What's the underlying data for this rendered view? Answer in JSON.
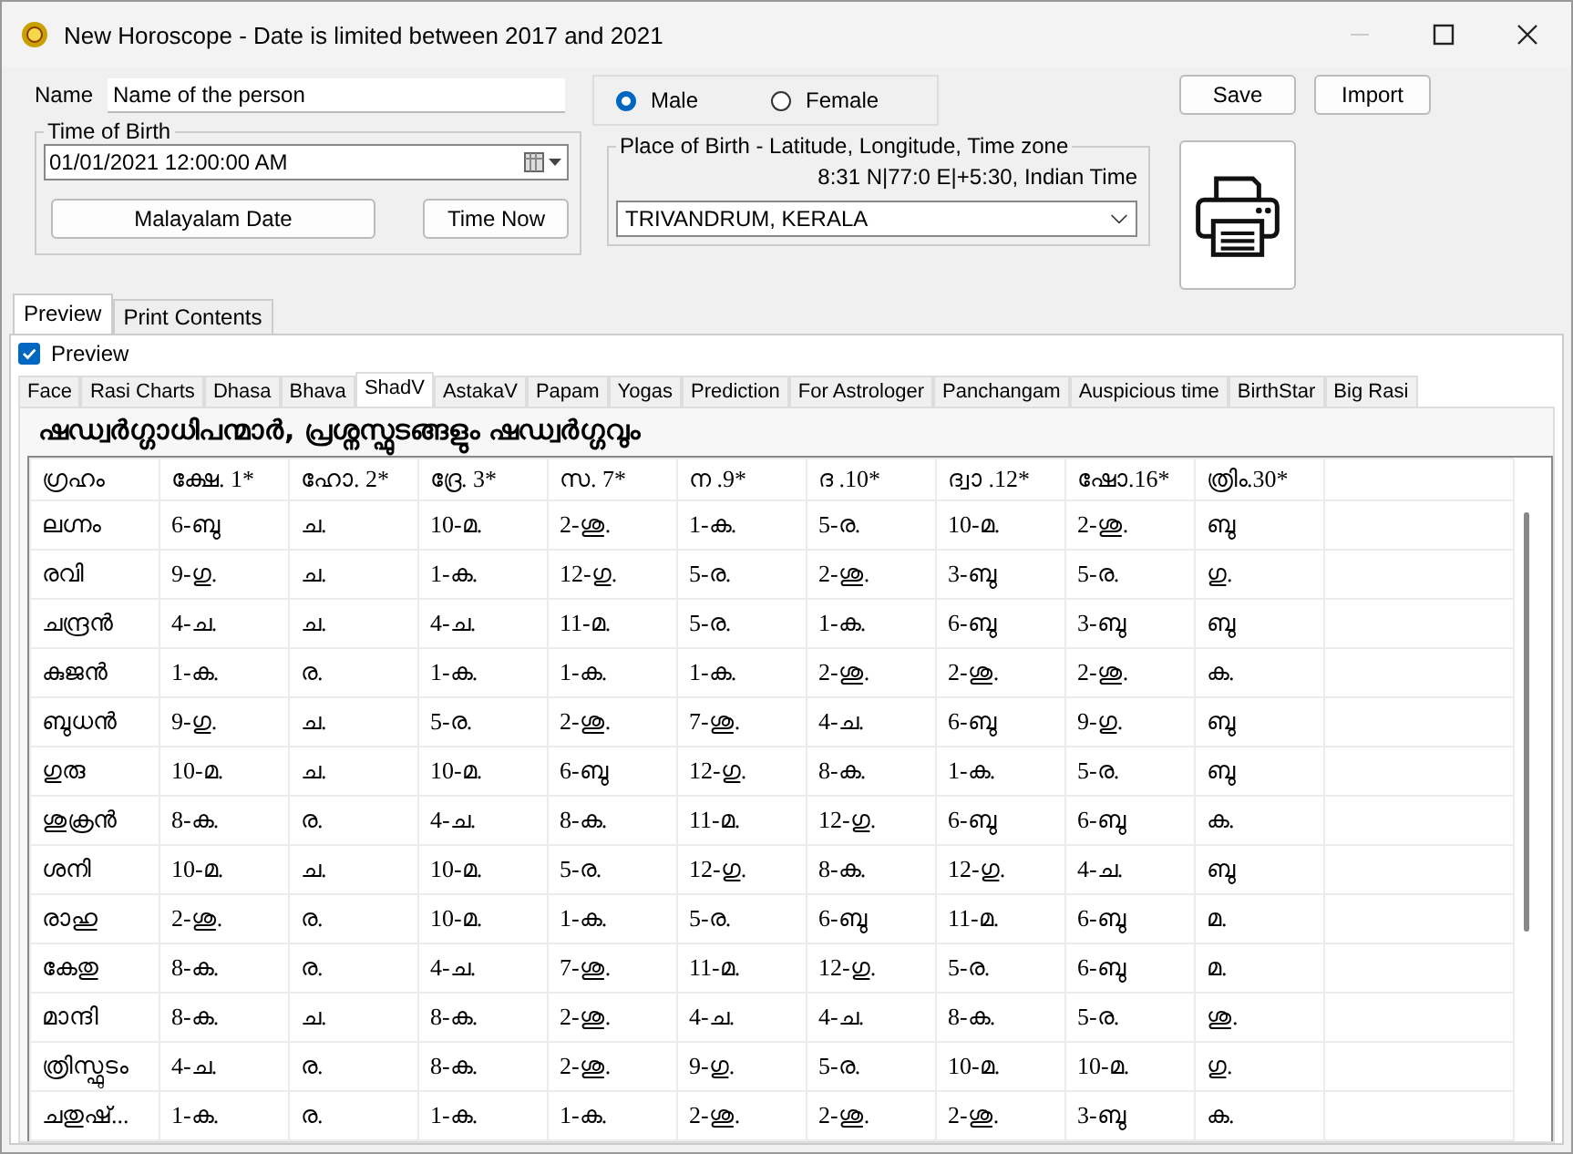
{
  "window": {
    "title": "New Horoscope - Date is limited between 2017 and 2021"
  },
  "form": {
    "name_label": "Name",
    "name_value": "Name of the person",
    "gender": [
      {
        "label": "Male",
        "selected": true
      },
      {
        "label": "Female",
        "selected": false
      }
    ],
    "time_group": "Time of Birth",
    "datetime_value": "01/01/2021  12:00:00 AM",
    "malayalam_date_button": "Malayalam Date",
    "time_now_button": "Time Now",
    "place_group": "Place of Birth - Latitude, Longitude, Time zone",
    "coordinates": "8:31 N|77:0 E|+5:30, Indian Time",
    "place_value": "TRIVANDRUM, KERALA",
    "save_button": "Save",
    "import_button": "Import"
  },
  "outer_tabs": [
    {
      "label": "Preview",
      "selected": true
    },
    {
      "label": "Print Contents",
      "selected": false
    }
  ],
  "preview_checkbox": {
    "label": "Preview",
    "checked": true
  },
  "tabs": [
    {
      "label": "Face",
      "selected": false
    },
    {
      "label": "Rasi Charts",
      "selected": false
    },
    {
      "label": "Dhasa",
      "selected": false
    },
    {
      "label": "Bhava",
      "selected": false
    },
    {
      "label": "ShadV",
      "selected": true
    },
    {
      "label": "AstakaV",
      "selected": false
    },
    {
      "label": "Papam",
      "selected": false
    },
    {
      "label": "Yogas",
      "selected": false
    },
    {
      "label": "Prediction",
      "selected": false
    },
    {
      "label": "For Astrologer",
      "selected": false
    },
    {
      "label": "Panchangam",
      "selected": false
    },
    {
      "label": "Auspicious time",
      "selected": false
    },
    {
      "label": "BirthStar",
      "selected": false
    },
    {
      "label": "Big Rasi",
      "selected": false
    }
  ],
  "heading": "ഷഡ്വർഗ്ഗാധിപന്മാർ, പ്രശ്നസ്ഫുടങ്ങളും ഷഡ്വർഗ്ഗവും",
  "table": {
    "columns": [
      "ഗ്രഹം",
      "ക്ഷേ. 1*",
      "ഹോ. 2*",
      "ദ്രേ. 3*",
      "സ. 7*",
      "ന .9*",
      "ദ .10*",
      "ദ്വാ .12*",
      "ഷോ.16*",
      "ത്രിം.30*"
    ],
    "rows": [
      [
        "ലഗ്നം",
        "6-ബു",
        "ച.",
        "10-മ.",
        "2-ശു.",
        "1-ക.",
        "5-ര.",
        "10-മ.",
        "2-ശു.",
        "ബു"
      ],
      [
        "രവി",
        "9-ഗു.",
        "ച.",
        "1-ക.",
        "12-ഗു.",
        "5-ര.",
        "2-ശു.",
        "3-ബു",
        "5-ര.",
        "ഗു."
      ],
      [
        "ചന്ദ്രൻ",
        "4-ച.",
        "ച.",
        "4-ച.",
        "11-മ.",
        "5-ര.",
        "1-ക.",
        "6-ബു",
        "3-ബു",
        "ബു"
      ],
      [
        "കുജൻ",
        "1-ക.",
        "ര.",
        "1-ക.",
        "1-ക.",
        "1-ക.",
        "2-ശു.",
        "2-ശു.",
        "2-ശു.",
        "ക."
      ],
      [
        "ബുധൻ",
        "9-ഗു.",
        "ച.",
        "5-ര.",
        "2-ശു.",
        "7-ശു.",
        "4-ച.",
        "6-ബു",
        "9-ഗു.",
        "ബു"
      ],
      [
        "ഗുരു",
        "10-മ.",
        "ച.",
        "10-മ.",
        "6-ബു",
        "12-ഗു.",
        "8-ക.",
        "1-ക.",
        "5-ര.",
        "ബു"
      ],
      [
        "ശുക്രൻ",
        "8-ക.",
        "ര.",
        "4-ച.",
        "8-ക.",
        "11-മ.",
        "12-ഗു.",
        "6-ബു",
        "6-ബു",
        "ക."
      ],
      [
        "ശനി",
        "10-മ.",
        "ച.",
        "10-മ.",
        "5-ര.",
        "12-ഗു.",
        "8-ക.",
        "12-ഗു.",
        "4-ച.",
        "ബു"
      ],
      [
        "രാഹു",
        "2-ശു.",
        "ര.",
        "10-മ.",
        "1-ക.",
        "5-ര.",
        "6-ബു",
        "11-മ.",
        "6-ബു",
        "മ."
      ],
      [
        "കേതു",
        "8-ക.",
        "ര.",
        "4-ച.",
        "7-ശു.",
        "11-മ.",
        "12-ഗു.",
        "5-ര.",
        "6-ബു",
        "മ."
      ],
      [
        "മാന്ദി",
        "8-ക.",
        "ച.",
        "8-ക.",
        "2-ശു.",
        "4-ച.",
        "4-ച.",
        "8-ക.",
        "5-ര.",
        "ശു."
      ],
      [
        "ത്രിസ്ഫുടം",
        "4-ച.",
        "ര.",
        "8-ക.",
        "2-ശു.",
        "9-ഗു.",
        "5-ര.",
        "10-മ.",
        "10-മ.",
        "ഗു."
      ],
      [
        "ചതുഷ്...",
        "1-ക.",
        "ര.",
        "1-ക.",
        "1-ക.",
        "2-ശു.",
        "2-ശു.",
        "2-ശു.",
        "3-ബു",
        "ക."
      ]
    ]
  }
}
